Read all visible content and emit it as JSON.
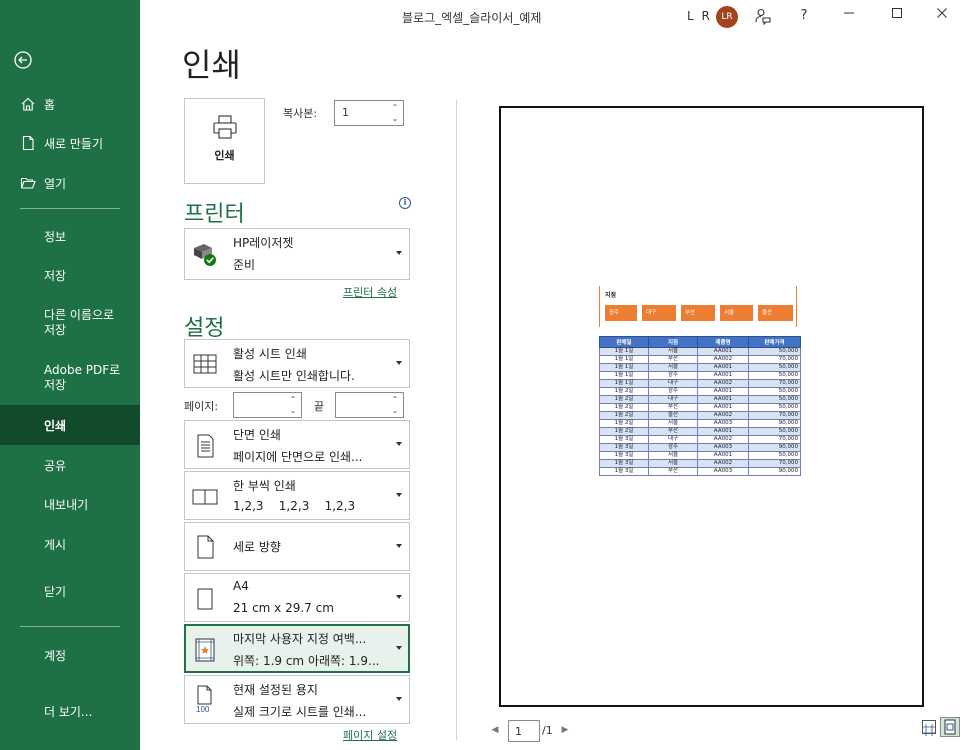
{
  "titlebar": {
    "title": "블로그_엑셀_슬라이서_예제",
    "user_name": "L R",
    "avatar_initials": "LR",
    "help": "?"
  },
  "sidebar": {
    "items": [
      {
        "label": "홈"
      },
      {
        "label": "새로 만들기"
      },
      {
        "label": "열기"
      },
      {
        "label": "정보"
      },
      {
        "label": "저장"
      },
      {
        "label": "다른 이름으로\n저장"
      },
      {
        "label": "Adobe PDF로\n저장"
      },
      {
        "label": "인쇄"
      },
      {
        "label": "공유"
      },
      {
        "label": "내보내기"
      },
      {
        "label": "게시"
      },
      {
        "label": "닫기"
      },
      {
        "label": "계정"
      },
      {
        "label": "더 보기..."
      }
    ]
  },
  "main": {
    "heading": "인쇄",
    "print_button": "인쇄",
    "copies_label": "복사본:",
    "copies_value": "1",
    "printer_section": "프린터",
    "printer": {
      "name": "HP레이저젯",
      "status": "준비"
    },
    "printer_properties": "프린터 속성",
    "settings_section": "설정",
    "settings": [
      {
        "l1": "활성 시트 인쇄",
        "l2": "활성 시트만 인쇄합니다."
      },
      {
        "l1": "단면 인쇄",
        "l2": "페이지에 단면으로 인쇄..."
      },
      {
        "l1": "한 부씩 인쇄",
        "l2": "1,2,3    1,2,3    1,2,3"
      },
      {
        "l1": "세로 방향",
        "l2": ""
      },
      {
        "l1": "A4",
        "l2": "21 cm x 29.7 cm"
      },
      {
        "l1": "마지막 사용자 지정 여백...",
        "l2": "위쪽: 1.9 cm 아래쪽: 1.9..."
      },
      {
        "l1": "현재 설정된 용지",
        "l2": "실제 크기로 시트를 인쇄..."
      }
    ],
    "pages_label": "페이지:",
    "to_label": "끝",
    "scale_icon_text": "100",
    "page_setup": "페이지 설정"
  },
  "preview": {
    "branch_title": "지점",
    "branches": [
      "광주",
      "대구",
      "부산",
      "서울",
      "울산"
    ],
    "headers": [
      "판매일",
      "지점",
      "제품명",
      "판매가격"
    ],
    "rows": [
      [
        "1월 1일",
        "서울",
        "AA001",
        "50,000"
      ],
      [
        "1월 1일",
        "부산",
        "AA002",
        "70,000"
      ],
      [
        "1월 1일",
        "서울",
        "AA001",
        "50,000"
      ],
      [
        "1월 1일",
        "광주",
        "AA001",
        "50,000"
      ],
      [
        "1월 1일",
        "대구",
        "AA002",
        "70,000"
      ],
      [
        "1월 2일",
        "광주",
        "AA001",
        "50,000"
      ],
      [
        "1월 2일",
        "대구",
        "AA001",
        "50,000"
      ],
      [
        "1월 2일",
        "부산",
        "AA001",
        "50,000"
      ],
      [
        "1월 2일",
        "울산",
        "AA002",
        "70,000"
      ],
      [
        "1월 2일",
        "서울",
        "AA003",
        "90,000"
      ],
      [
        "1월 2일",
        "부산",
        "AA001",
        "50,000"
      ],
      [
        "1월 3일",
        "대구",
        "AA002",
        "70,000"
      ],
      [
        "1월 3일",
        "광주",
        "AA003",
        "90,000"
      ],
      [
        "1월 3일",
        "서울",
        "AA001",
        "50,000"
      ],
      [
        "1월 3일",
        "서울",
        "AA002",
        "70,000"
      ],
      [
        "1월 3일",
        "부산",
        "AA003",
        "90,000"
      ]
    ],
    "current_page": "1",
    "total_pages": "/1"
  },
  "colors": {
    "sidebar": "#1e7145",
    "sidebar_active": "#124a2c",
    "accent": "#1e7145",
    "chip": "#ed7d31",
    "table_header": "#4472c4",
    "table_band": "#d9e1f2"
  }
}
